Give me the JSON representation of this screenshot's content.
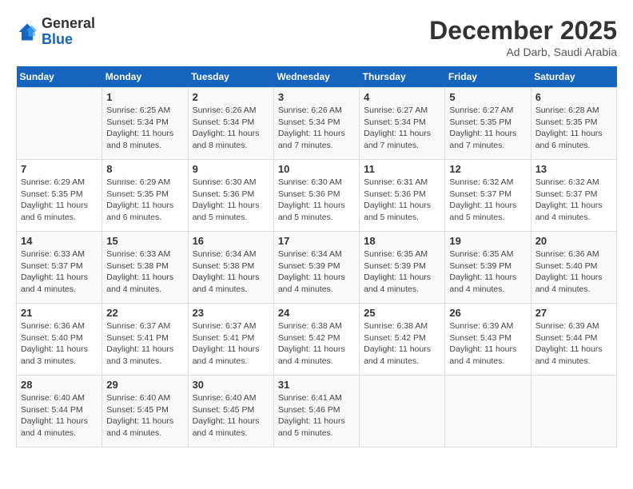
{
  "header": {
    "logo_general": "General",
    "logo_blue": "Blue",
    "month": "December 2025",
    "location": "Ad Darb, Saudi Arabia"
  },
  "weekdays": [
    "Sunday",
    "Monday",
    "Tuesday",
    "Wednesday",
    "Thursday",
    "Friday",
    "Saturday"
  ],
  "weeks": [
    [
      {
        "day": "",
        "info": ""
      },
      {
        "day": "1",
        "info": "Sunrise: 6:25 AM\nSunset: 5:34 PM\nDaylight: 11 hours\nand 8 minutes."
      },
      {
        "day": "2",
        "info": "Sunrise: 6:26 AM\nSunset: 5:34 PM\nDaylight: 11 hours\nand 8 minutes."
      },
      {
        "day": "3",
        "info": "Sunrise: 6:26 AM\nSunset: 5:34 PM\nDaylight: 11 hours\nand 7 minutes."
      },
      {
        "day": "4",
        "info": "Sunrise: 6:27 AM\nSunset: 5:34 PM\nDaylight: 11 hours\nand 7 minutes."
      },
      {
        "day": "5",
        "info": "Sunrise: 6:27 AM\nSunset: 5:35 PM\nDaylight: 11 hours\nand 7 minutes."
      },
      {
        "day": "6",
        "info": "Sunrise: 6:28 AM\nSunset: 5:35 PM\nDaylight: 11 hours\nand 6 minutes."
      }
    ],
    [
      {
        "day": "7",
        "info": "Sunrise: 6:29 AM\nSunset: 5:35 PM\nDaylight: 11 hours\nand 6 minutes."
      },
      {
        "day": "8",
        "info": "Sunrise: 6:29 AM\nSunset: 5:35 PM\nDaylight: 11 hours\nand 6 minutes."
      },
      {
        "day": "9",
        "info": "Sunrise: 6:30 AM\nSunset: 5:36 PM\nDaylight: 11 hours\nand 5 minutes."
      },
      {
        "day": "10",
        "info": "Sunrise: 6:30 AM\nSunset: 5:36 PM\nDaylight: 11 hours\nand 5 minutes."
      },
      {
        "day": "11",
        "info": "Sunrise: 6:31 AM\nSunset: 5:36 PM\nDaylight: 11 hours\nand 5 minutes."
      },
      {
        "day": "12",
        "info": "Sunrise: 6:32 AM\nSunset: 5:37 PM\nDaylight: 11 hours\nand 5 minutes."
      },
      {
        "day": "13",
        "info": "Sunrise: 6:32 AM\nSunset: 5:37 PM\nDaylight: 11 hours\nand 4 minutes."
      }
    ],
    [
      {
        "day": "14",
        "info": "Sunrise: 6:33 AM\nSunset: 5:37 PM\nDaylight: 11 hours\nand 4 minutes."
      },
      {
        "day": "15",
        "info": "Sunrise: 6:33 AM\nSunset: 5:38 PM\nDaylight: 11 hours\nand 4 minutes."
      },
      {
        "day": "16",
        "info": "Sunrise: 6:34 AM\nSunset: 5:38 PM\nDaylight: 11 hours\nand 4 minutes."
      },
      {
        "day": "17",
        "info": "Sunrise: 6:34 AM\nSunset: 5:39 PM\nDaylight: 11 hours\nand 4 minutes."
      },
      {
        "day": "18",
        "info": "Sunrise: 6:35 AM\nSunset: 5:39 PM\nDaylight: 11 hours\nand 4 minutes."
      },
      {
        "day": "19",
        "info": "Sunrise: 6:35 AM\nSunset: 5:39 PM\nDaylight: 11 hours\nand 4 minutes."
      },
      {
        "day": "20",
        "info": "Sunrise: 6:36 AM\nSunset: 5:40 PM\nDaylight: 11 hours\nand 4 minutes."
      }
    ],
    [
      {
        "day": "21",
        "info": "Sunrise: 6:36 AM\nSunset: 5:40 PM\nDaylight: 11 hours\nand 3 minutes."
      },
      {
        "day": "22",
        "info": "Sunrise: 6:37 AM\nSunset: 5:41 PM\nDaylight: 11 hours\nand 3 minutes."
      },
      {
        "day": "23",
        "info": "Sunrise: 6:37 AM\nSunset: 5:41 PM\nDaylight: 11 hours\nand 4 minutes."
      },
      {
        "day": "24",
        "info": "Sunrise: 6:38 AM\nSunset: 5:42 PM\nDaylight: 11 hours\nand 4 minutes."
      },
      {
        "day": "25",
        "info": "Sunrise: 6:38 AM\nSunset: 5:42 PM\nDaylight: 11 hours\nand 4 minutes."
      },
      {
        "day": "26",
        "info": "Sunrise: 6:39 AM\nSunset: 5:43 PM\nDaylight: 11 hours\nand 4 minutes."
      },
      {
        "day": "27",
        "info": "Sunrise: 6:39 AM\nSunset: 5:44 PM\nDaylight: 11 hours\nand 4 minutes."
      }
    ],
    [
      {
        "day": "28",
        "info": "Sunrise: 6:40 AM\nSunset: 5:44 PM\nDaylight: 11 hours\nand 4 minutes."
      },
      {
        "day": "29",
        "info": "Sunrise: 6:40 AM\nSunset: 5:45 PM\nDaylight: 11 hours\nand 4 minutes."
      },
      {
        "day": "30",
        "info": "Sunrise: 6:40 AM\nSunset: 5:45 PM\nDaylight: 11 hours\nand 4 minutes."
      },
      {
        "day": "31",
        "info": "Sunrise: 6:41 AM\nSunset: 5:46 PM\nDaylight: 11 hours\nand 5 minutes."
      },
      {
        "day": "",
        "info": ""
      },
      {
        "day": "",
        "info": ""
      },
      {
        "day": "",
        "info": ""
      }
    ]
  ]
}
